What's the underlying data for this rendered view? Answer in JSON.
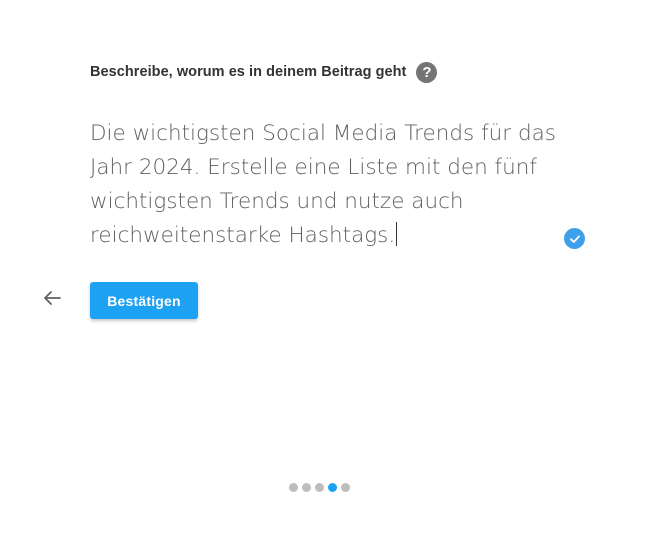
{
  "form": {
    "prompt_label": "Beschreibe, worum es in deinem Beitrag geht",
    "help_icon": "question-mark-icon",
    "help_glyph": "?",
    "description_value": "Die wichtigsten Social Media Trends für das Jahr 2024. Erstelle eine Liste mit den fünf wichtigsten Trends und nutze auch reichweitenstarke Hashtags.",
    "valid_icon": "check-circle-icon",
    "back_icon": "arrow-left-icon",
    "confirm_label": "Bestätigen"
  },
  "stepper": {
    "total_steps": 5,
    "current_step": 4
  },
  "colors": {
    "accent": "#1DA1F2",
    "check": "#3FA0EA",
    "dot_inactive": "#BDBDBD",
    "icon_gray": "#757575",
    "arrow_gray": "#616161"
  }
}
